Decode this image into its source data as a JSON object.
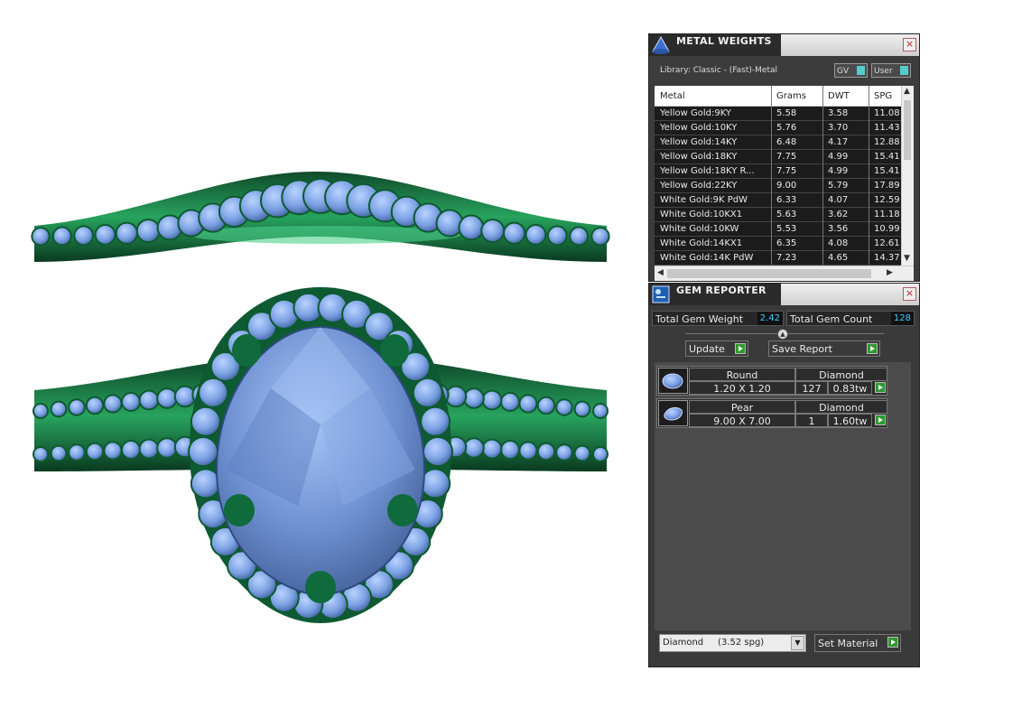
{
  "metal_weights": {
    "title": "METAL WEIGHTS",
    "close": "×",
    "library": "Library: Classic - (Fast)-Metal",
    "toggle_gv": "GV",
    "toggle_user": "User",
    "columns": [
      "Metal",
      "Grams",
      "DWT",
      "SPG"
    ],
    "rows": [
      [
        "Yellow Gold:9KY",
        "5.58",
        "3.58",
        "11.08"
      ],
      [
        "Yellow Gold:10KY",
        "5.76",
        "3.70",
        "11.43"
      ],
      [
        "Yellow Gold:14KY",
        "6.48",
        "4.17",
        "12.88"
      ],
      [
        "Yellow Gold:18KY",
        "7.75",
        "4.99",
        "15.41"
      ],
      [
        "Yellow Gold:18KY R...",
        "7.75",
        "4.99",
        "15.41"
      ],
      [
        "Yellow Gold:22KY",
        "9.00",
        "5.79",
        "17.89"
      ],
      [
        "White Gold:9K PdW",
        "6.33",
        "4.07",
        "12.59"
      ],
      [
        "White Gold:10KX1",
        "5.63",
        "3.62",
        "11.18"
      ],
      [
        "White Gold:10KW",
        "5.53",
        "3.56",
        "10.99"
      ],
      [
        "White Gold:14KX1",
        "6.35",
        "4.08",
        "12.61"
      ],
      [
        "White Gold:14K PdW",
        "7.23",
        "4.65",
        "14.37"
      ]
    ]
  },
  "gem_reporter": {
    "title": "GEM REPORTER",
    "close": "×",
    "total_weight_label": "Total Gem Weight",
    "total_weight_value": "2.42",
    "total_count_label": "Total Gem Count",
    "total_count_value": "128",
    "update_label": "Update",
    "save_label": "Save Report",
    "gems": [
      {
        "shape": "Round",
        "material": "Diamond",
        "size": "1.20 X 1.20",
        "count": "127",
        "weight": "0.83tw"
      },
      {
        "shape": "Pear",
        "material": "Diamond",
        "size": "9.00 X 7.00",
        "count": "1",
        "weight": "1.60tw"
      }
    ],
    "material_select": "Diamond     (3.52 spg)",
    "set_material_label": "Set Material"
  },
  "colors": {
    "metal_green": "#1f7a4a",
    "gem_blue": "#7fa6e6",
    "value_cyan": "#38d0ff",
    "go_green": "#2e9a2e"
  }
}
